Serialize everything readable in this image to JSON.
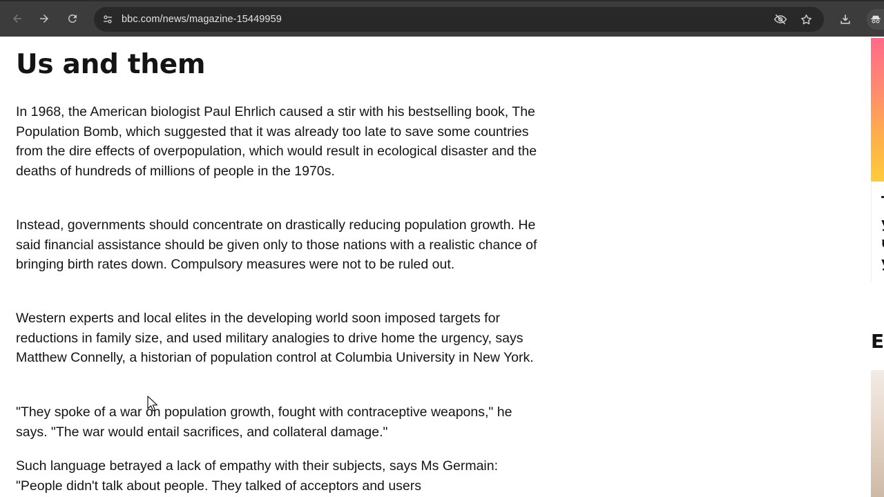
{
  "browser": {
    "url": "bbc.com/news/magazine-15449959",
    "icons": {
      "back": "arrow-left-icon",
      "forward": "arrow-right-icon",
      "reload": "reload-icon",
      "site_info": "tune-icon",
      "tracking": "eye-off-icon",
      "bookmark": "star-icon",
      "download": "download-icon",
      "incognito": "incognito-icon"
    },
    "colors": {
      "toolbar": "#3c3c3c",
      "omnibox": "#282828",
      "text": "#e3e3e3"
    }
  },
  "article": {
    "headline": "Us and them",
    "paragraphs": [
      "In 1968, the American biologist Paul Ehrlich caused a stir with his bestselling book, The Population Bomb, which suggested that it was already too late to save some countries from the dire effects of overpopulation, which would result in ecological disaster and the deaths of hundreds of millions of people in the 1970s.",
      "Instead, governments should concentrate on drastically reducing population growth. He said financial assistance should be given only to those nations with a realistic chance of bringing birth rates down. Compulsory measures were not to be ruled out.",
      "Western experts and local elites in the developing world soon imposed targets for reductions in family size, and used military analogies to drive home the urgency, says Matthew Connelly, a historian of population control at Columbia University in New York.",
      "\"They spoke of a war on population growth, fought with contraceptive weapons,\" he says. \"The war would entail sacrifices, and collateral damage.\"",
      "Such language betrayed a lack of empathy with their subjects, says Ms Germain: \"People didn't talk about people. They talked of acceptors and users"
    ]
  },
  "sidebar": {
    "fragments": [
      "T",
      "y",
      "u",
      "y"
    ],
    "section_initial": "E"
  }
}
